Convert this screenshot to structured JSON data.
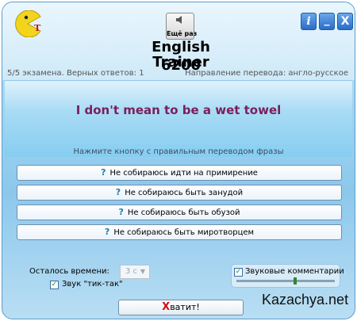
{
  "window": {
    "title_line1": "English Trainer",
    "title_line2": "6200",
    "again_label": "Ещё раз",
    "info_label": "i",
    "minimize_label": "_",
    "close_label": "X"
  },
  "status": {
    "left": "5/5 экзамена. Верных ответов: 1",
    "right": "Направление перевода: англо-русское"
  },
  "phrase": "I don't mean to be a wet towel",
  "hint": "Нажмите кнопку с правильным переводом фразы",
  "answers": [
    {
      "label": "Не собираюсь идти на примирение"
    },
    {
      "label": "Не собираюсь быть занудой"
    },
    {
      "label": "Не собираюсь быть обузой"
    },
    {
      "label": "Не собираюсь быть миротворцем"
    }
  ],
  "answer_icon": "?",
  "timer": {
    "label": "Осталось времени:",
    "value": "3 с"
  },
  "tick_tock": {
    "label": "Звук \"тик-так\"",
    "checked": true
  },
  "sound_comments": {
    "label": "Звуковые комментарии",
    "checked": true,
    "level": 0.6
  },
  "exit_label": "Хватит!",
  "watermark": "Kazachya.net",
  "colors": {
    "accent": "#2a6cc8",
    "phrase": "#7a1f5a",
    "icon": "#1a7fa8"
  }
}
